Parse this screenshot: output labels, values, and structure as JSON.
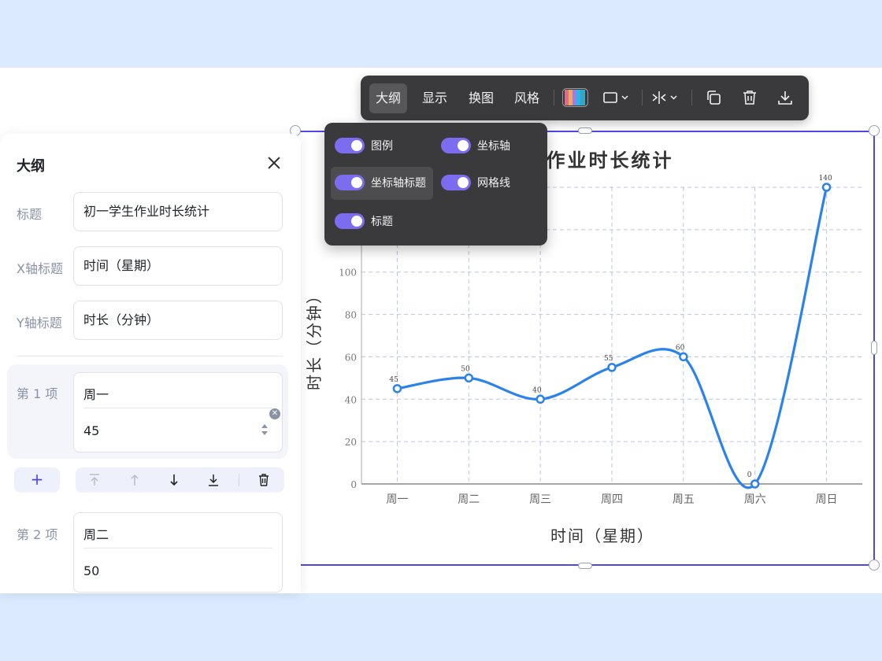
{
  "toolbar": {
    "tabs": [
      {
        "label": "大纲",
        "active": true
      },
      {
        "label": "显示",
        "active": false
      },
      {
        "label": "换图",
        "active": false
      },
      {
        "label": "风格",
        "active": false
      }
    ],
    "icons": [
      "palette-icon",
      "shape-select-icon",
      "arrange-icon",
      "copy-icon",
      "delete-icon",
      "download-icon"
    ]
  },
  "display_menu": {
    "options": [
      {
        "label": "图例",
        "on": true
      },
      {
        "label": "坐标轴",
        "on": true
      },
      {
        "label": "坐标轴标题",
        "on": true
      },
      {
        "label": "网格线",
        "on": true
      },
      {
        "label": "标题",
        "on": true
      }
    ]
  },
  "outline": {
    "title": "大纲",
    "fields": [
      {
        "label": "标题",
        "value": "初一学生作业时长统计"
      },
      {
        "label": "X轴标题",
        "value": "时间（星期）"
      },
      {
        "label": "Y轴标题",
        "value": "时长（分钟）"
      }
    ],
    "items": [
      {
        "label": "第 1 项",
        "name": "周一",
        "value": "45"
      },
      {
        "label": "第 2 项",
        "name": "周二",
        "value": "50"
      }
    ],
    "add_label": "+"
  },
  "chart_data": {
    "type": "line",
    "title": "生作业时长统计",
    "xlabel": "时间（星期）",
    "ylabel": "时长（分钟）",
    "categories": [
      "周一",
      "周二",
      "周三",
      "周四",
      "周五",
      "周六",
      "周日"
    ],
    "values": [
      45,
      50,
      40,
      55,
      60,
      0,
      140
    ],
    "ylim": [
      0,
      140
    ],
    "yticks": [
      0,
      20,
      40,
      60,
      80,
      100
    ],
    "grid": true,
    "line_color": "#2b82ea",
    "style": "hand-drawn"
  }
}
